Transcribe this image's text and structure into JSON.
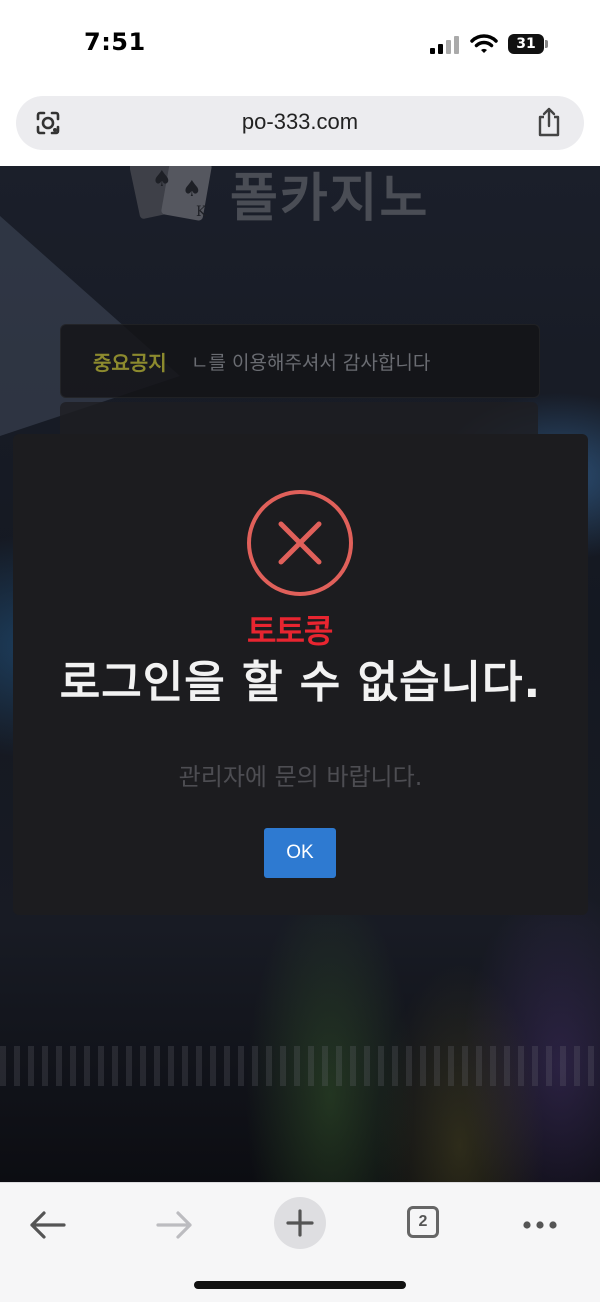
{
  "status_bar": {
    "time": "7:51",
    "battery": "31"
  },
  "browser": {
    "url": "po-333.com",
    "tab_count": "2"
  },
  "page": {
    "logo_text": "폴카지노",
    "notice": {
      "label": "중요공지",
      "text": "ㄴ를 이용해주셔서 감사합니다"
    }
  },
  "modal": {
    "title": "로그인을 할 수 없습니다.",
    "message": "관리자에 문의 바랍니다.",
    "ok_label": "OK",
    "watermark": "토토콩"
  },
  "colors": {
    "error_ring": "#e0605a",
    "ok_button": "#2e7ad1",
    "notice_label": "#8c8a2e",
    "watermark": "#e82530"
  }
}
